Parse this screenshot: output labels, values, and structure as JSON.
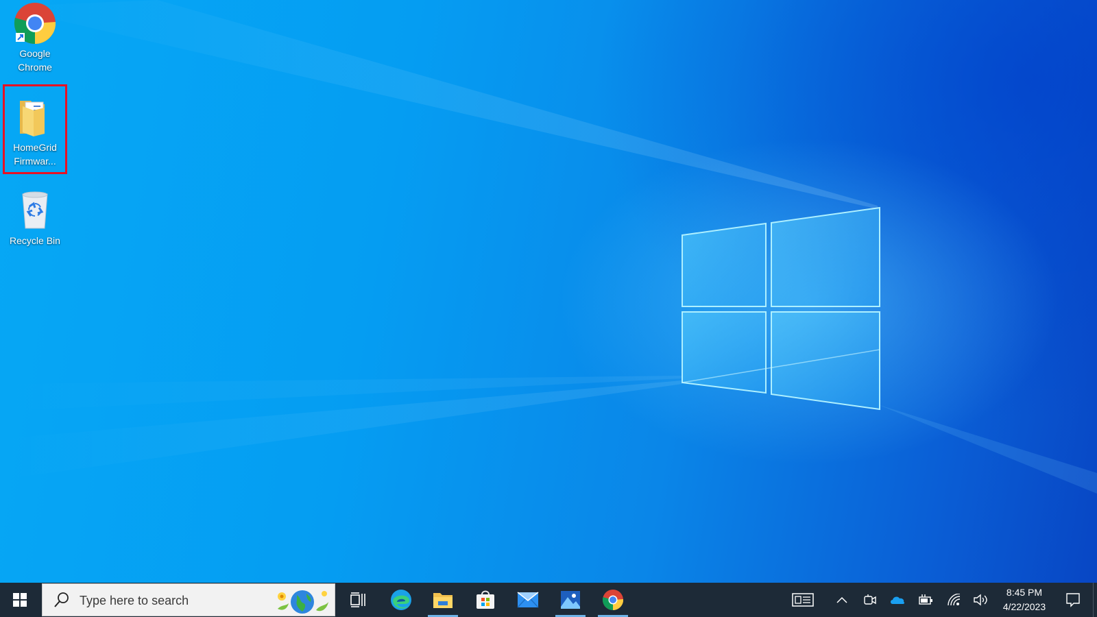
{
  "desktop": {
    "icons": [
      {
        "label": "Google\nChrome",
        "icon": "chrome-icon",
        "shortcut": true
      },
      {
        "label": "HomeGrid\nFirmwar...",
        "icon": "folder-icon",
        "highlighted": true,
        "highlight_color": "#e81123"
      },
      {
        "label": "Recycle Bin",
        "icon": "recycle-bin-icon"
      }
    ]
  },
  "taskbar": {
    "search_placeholder": "Type here to search",
    "pinned": [
      {
        "name": "task-view",
        "icon": "task-view-icon"
      },
      {
        "name": "edge",
        "icon": "edge-icon"
      },
      {
        "name": "file-explorer",
        "icon": "folder-icon",
        "active": true
      },
      {
        "name": "microsoft-store",
        "icon": "store-icon"
      },
      {
        "name": "mail",
        "icon": "mail-icon"
      },
      {
        "name": "photos",
        "icon": "photos-icon",
        "active": true
      },
      {
        "name": "chrome",
        "icon": "chrome-icon",
        "active": true
      }
    ],
    "tray": {
      "icons": [
        "news-icon",
        "chevron-up-icon",
        "meet-now-icon",
        "onedrive-icon",
        "battery-icon",
        "wifi-icon",
        "volume-icon"
      ],
      "time": "8:45 PM",
      "date": "4/22/2023",
      "notification_icon": "notification-icon"
    },
    "background_color": "#1d2a37"
  }
}
